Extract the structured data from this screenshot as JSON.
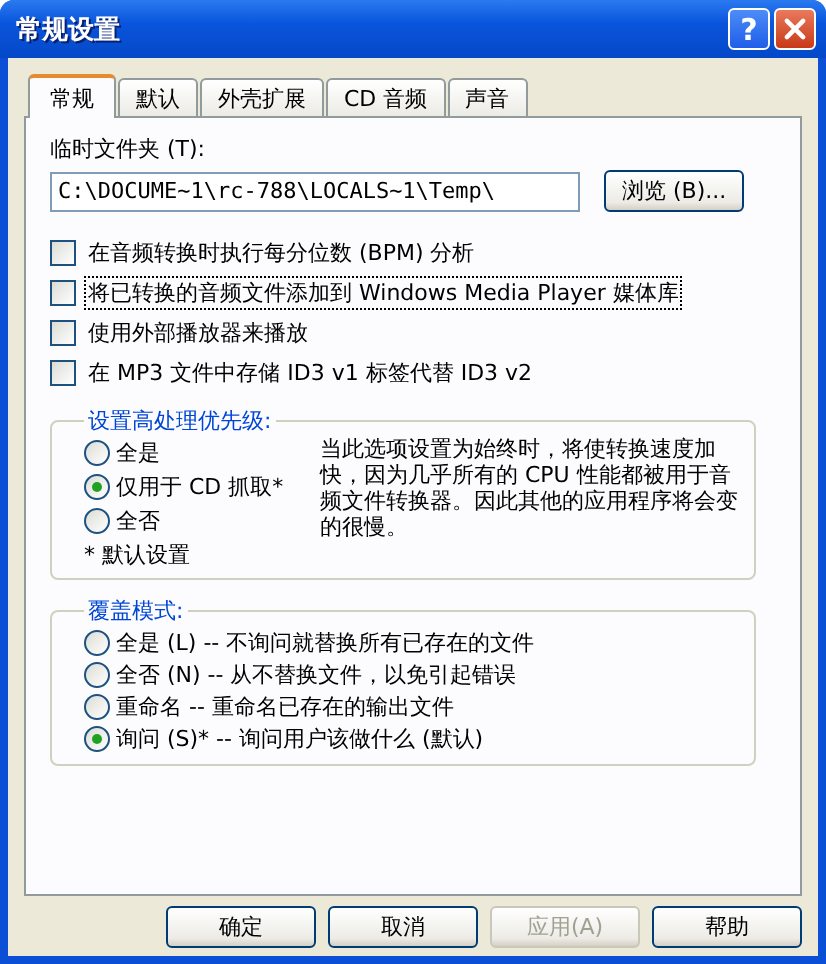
{
  "window": {
    "title": "常规设置",
    "help_button": "?"
  },
  "tabs": [
    {
      "label": "常规",
      "selected": true
    },
    {
      "label": "默认",
      "selected": false
    },
    {
      "label": "外壳扩展",
      "selected": false
    },
    {
      "label": "CD 音频",
      "selected": false
    },
    {
      "label": "声音",
      "selected": false
    }
  ],
  "temp_folder": {
    "label": "临时文件夹 (T):",
    "value": "C:\\DOCUME~1\\rc-788\\LOCALS~1\\Temp\\",
    "browse_button": "浏览 (B)..."
  },
  "options": [
    {
      "label": "在音频转换时执行每分位数 (BPM) 分析",
      "checked": false,
      "focused": false
    },
    {
      "label": "将已转换的音频文件添加到 Windows Media Player 媒体库",
      "checked": false,
      "focused": true
    },
    {
      "label": "使用外部播放器来播放",
      "checked": false,
      "focused": false
    },
    {
      "label": "在 MP3 文件中存储 ID3 v1 标签代替 ID3 v2",
      "checked": false,
      "focused": false
    }
  ],
  "priority": {
    "title": "设置高处理优先级:",
    "choices": [
      {
        "label": "全是",
        "selected": false
      },
      {
        "label": "仅用于 CD 抓取*",
        "selected": true
      },
      {
        "label": "全否",
        "selected": false
      }
    ],
    "note": "* 默认设置",
    "description": "当此选项设置为始终时，将使转换速度加快，因为几乎所有的 CPU 性能都被用于音频文件转换器。因此其他的应用程序将会变的很慢。"
  },
  "overwrite": {
    "title": "覆盖模式:",
    "choices": [
      {
        "label": "全是 (L) -- 不询问就替换所有已存在的文件",
        "selected": false
      },
      {
        "label": "全否 (N) -- 从不替换文件，以免引起错误",
        "selected": false
      },
      {
        "label": "重命名 -- 重命名已存在的输出文件",
        "selected": false
      },
      {
        "label": "询问 (S)* -- 询问用户该做什么 (默认)",
        "selected": true
      }
    ]
  },
  "buttons": [
    {
      "label": "确定",
      "disabled": false
    },
    {
      "label": "取消",
      "disabled": false
    },
    {
      "label": "应用(A)",
      "disabled": true
    },
    {
      "label": "帮助",
      "disabled": false
    }
  ]
}
